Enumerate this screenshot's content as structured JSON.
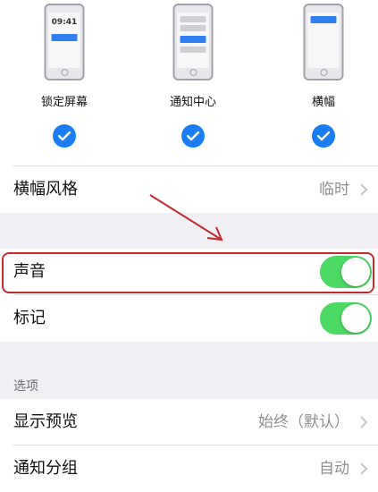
{
  "previews": [
    {
      "label": "锁定屏幕",
      "time": "09:41"
    },
    {
      "label": "通知中心"
    },
    {
      "label": "横幅"
    }
  ],
  "rows": {
    "banner_style": {
      "label": "横幅风格",
      "value": "临时"
    },
    "sounds": {
      "label": "声音",
      "enabled": true
    },
    "badges": {
      "label": "标记",
      "enabled": true
    },
    "section_options": "选项",
    "show_previews": {
      "label": "显示预览",
      "value": "始终（默认）"
    },
    "notification_grouping": {
      "label": "通知分组",
      "value": "自动"
    }
  },
  "colors": {
    "accent": "#1a7df3",
    "toggle_on": "#4cd964",
    "annotation": "#c32a2f"
  }
}
